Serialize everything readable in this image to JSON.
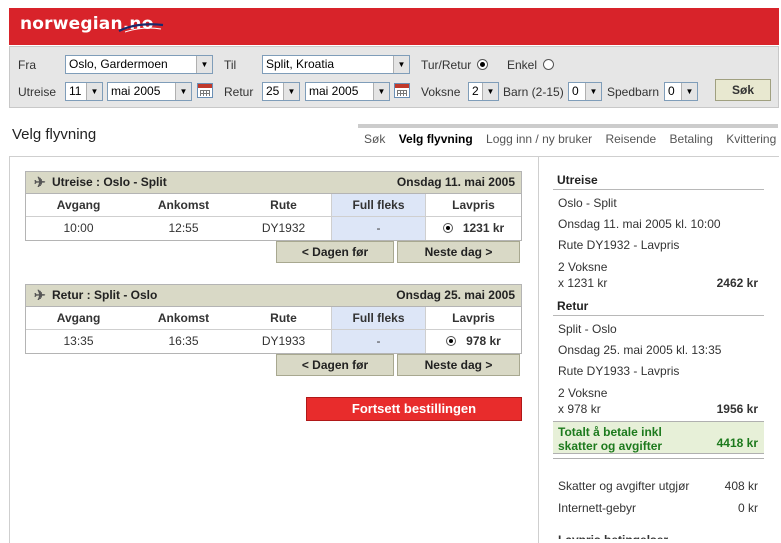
{
  "brand": {
    "logo_text": "norwegian.no",
    "brand_color": "#d8232a"
  },
  "search": {
    "from_label": "Fra",
    "from_value": "Oslo, Gardermoen",
    "to_label": "Til",
    "to_value": "Split, Kroatia",
    "roundtrip_label": "Tur/Retur",
    "oneway_label": "Enkel",
    "out_label": "Utreise",
    "out_day": "11",
    "out_month": "mai 2005",
    "ret_label": "Retur",
    "ret_day": "25",
    "ret_month": "mai 2005",
    "adults_label": "Voksne",
    "adults_value": "2",
    "children_label": "Barn (2-15)",
    "children_value": "0",
    "infants_label": "Spedbarn",
    "infants_value": "0",
    "search_button": "Søk"
  },
  "page": {
    "title": "Velg flyvning"
  },
  "steps": [
    "Søk",
    "Velg flyvning",
    "Logg inn / ny bruker",
    "Reisende",
    "Betaling",
    "Kvittering"
  ],
  "outbound": {
    "header_route": "Utreise : Oslo - Split",
    "header_date": "Onsdag 11. mai 2005",
    "columns": [
      "Avgang",
      "Ankomst",
      "Rute",
      "Full fleks",
      "Lavpris"
    ],
    "row": {
      "dep": "10:00",
      "arr": "12:55",
      "route": "DY1932",
      "flex": "-",
      "low": "1231 kr"
    },
    "prev_day": "< Dagen før",
    "next_day": "Neste dag >"
  },
  "return": {
    "header_route": "Retur : Split - Oslo",
    "header_date": "Onsdag 25. mai 2005",
    "columns": [
      "Avgang",
      "Ankomst",
      "Rute",
      "Full fleks",
      "Lavpris"
    ],
    "row": {
      "dep": "13:35",
      "arr": "16:35",
      "route": "DY1933",
      "flex": "-",
      "low": "978 kr"
    },
    "prev_day": "< Dagen før",
    "next_day": "Neste dag >"
  },
  "continue_button": "Fortsett bestillingen",
  "summary": {
    "out_title": "Utreise",
    "out_route": "Oslo - Split",
    "out_time": "Onsdag 11. mai 2005 kl. 10:00",
    "out_flight": "Rute DY1932 - Lavpris",
    "out_pax": "2 Voksne",
    "out_price_line": "x 1231 kr",
    "out_total": "2462 kr",
    "ret_title": "Retur",
    "ret_route": "Split - Oslo",
    "ret_time": "Onsdag 25. mai 2005 kl. 13:35",
    "ret_flight": "Rute DY1933 - Lavpris",
    "ret_pax": "2 Voksne",
    "ret_price_line": "x 978 kr",
    "ret_total": "1956 kr",
    "total_label_1": "Totalt å betale inkl",
    "total_label_2": "skatter og avgifter",
    "total_amount": "4418 kr",
    "tax_label": "Skatter og avgifter utgjør",
    "tax_amount": "408 kr",
    "fee_label": "Internett-gebyr",
    "fee_amount": "0 kr",
    "conditions_label": "Lavpris betingelser"
  }
}
